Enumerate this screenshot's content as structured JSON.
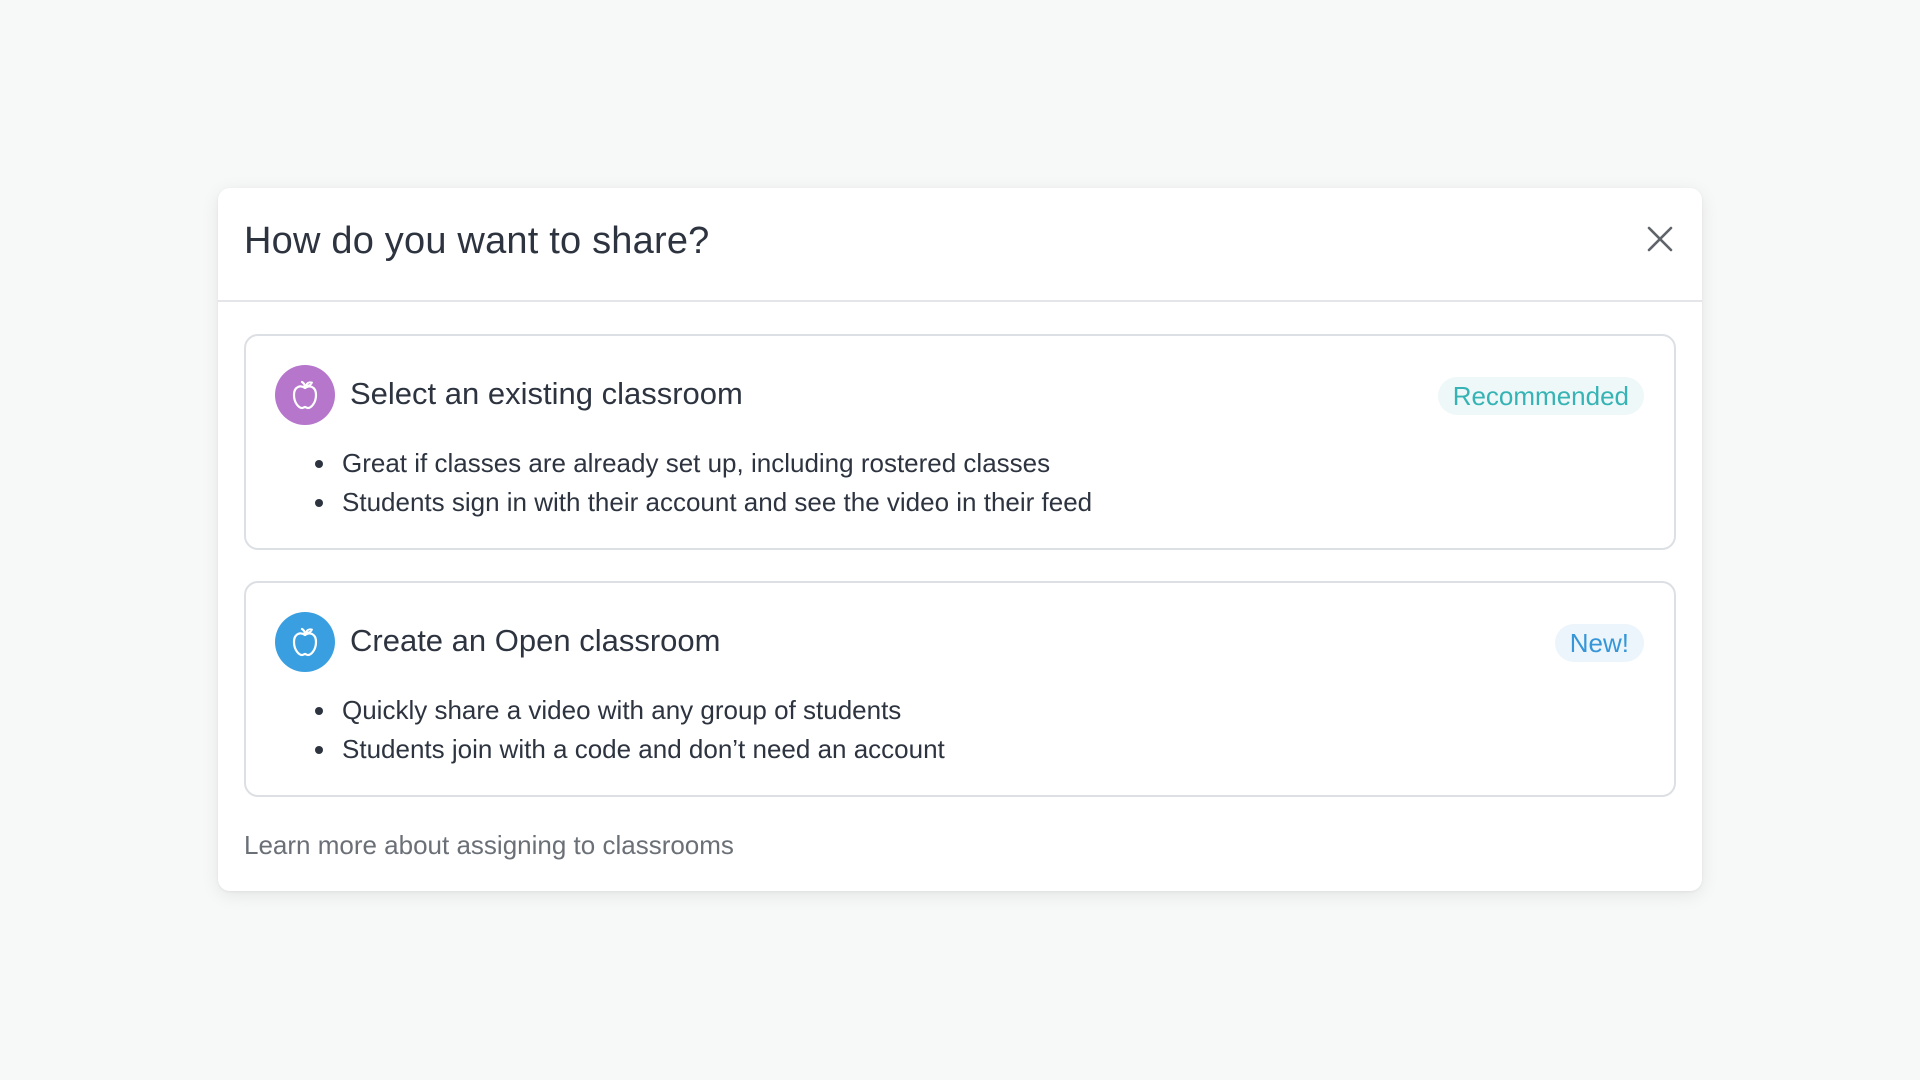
{
  "modal": {
    "title": "How do you want to share?",
    "close_icon": "close-icon",
    "options": [
      {
        "title": "Select an existing classroom",
        "badge": "Recommended",
        "icon": "apple-icon",
        "icon_color": "#b576cc",
        "bullets": [
          "Great if classes are already set up, including rostered classes",
          "Students sign in with their account and see the video in their feed"
        ]
      },
      {
        "title": "Create an Open classroom",
        "badge": "New!",
        "icon": "apple-icon",
        "icon_color": "#3a9fe0",
        "bullets": [
          "Quickly share a video with any group of students",
          "Students join with a code and don’t need an account"
        ]
      }
    ],
    "learn_more": "Learn more about assigning to classrooms"
  }
}
